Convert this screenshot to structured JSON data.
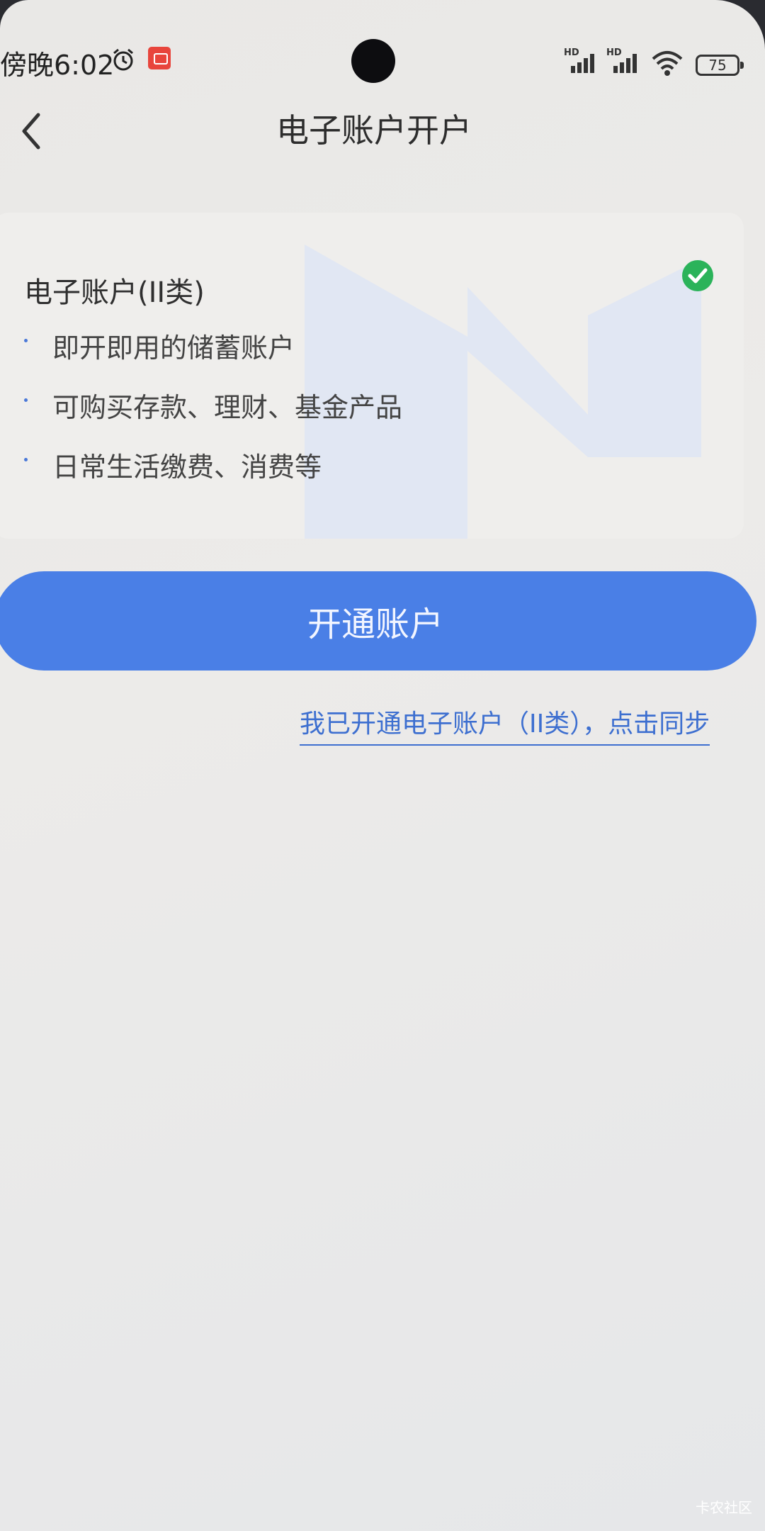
{
  "status_bar": {
    "time": "傍晚6:02",
    "battery": "75",
    "signal_labels": [
      "HD",
      "HD"
    ]
  },
  "header": {
    "title": "电子账户开户"
  },
  "card": {
    "title": "电子账户(II类)",
    "selected": true,
    "features": [
      "即开即用的储蓄账户",
      "可购买存款、理财、基金产品",
      "日常生活缴费、消费等"
    ]
  },
  "actions": {
    "open_button_label": "开通账户",
    "sync_link_label": "我已开通电子账户（II类），点击同步"
  },
  "watermark": "卡农社区",
  "colors": {
    "accent": "#4a7fe6",
    "link": "#3d6fd0",
    "check": "#2bb35a"
  }
}
